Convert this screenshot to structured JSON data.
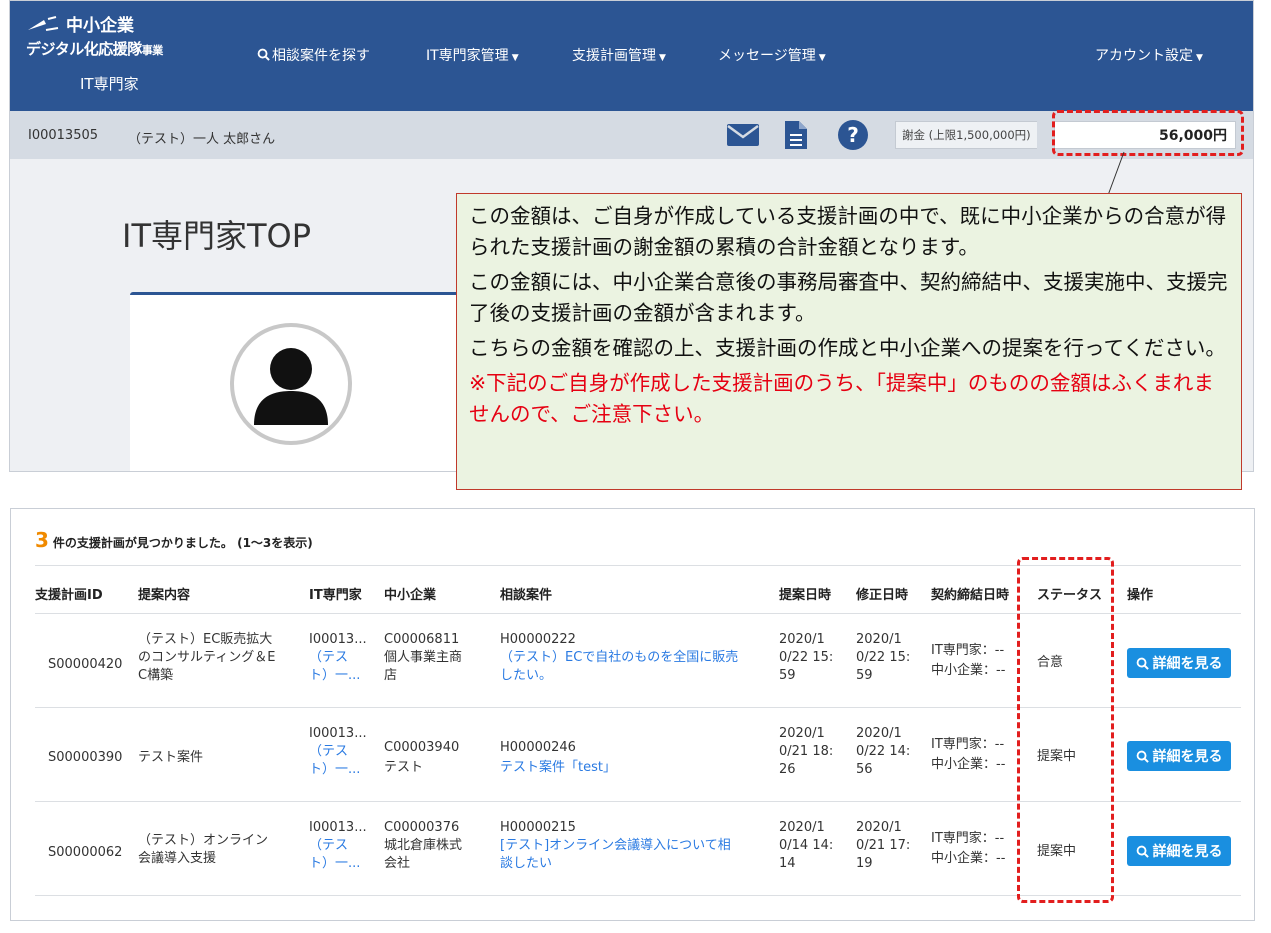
{
  "header": {
    "logo_line1": "中小企業",
    "logo_line2": "デジタル化応援隊",
    "logo_suffix": "事業",
    "role": "IT専門家",
    "nav": [
      {
        "label": "相談案件を探す"
      },
      {
        "label": "IT専門家管理"
      },
      {
        "label": "支援計画管理"
      },
      {
        "label": "メッセージ管理"
      }
    ],
    "account": "アカウント設定"
  },
  "subbar": {
    "user_id": "I00013505",
    "user_name": "（テスト）一人 太郎さん",
    "fee_label": "謝金 (上限1,500,000円)",
    "fee_value": "56,000円"
  },
  "page": {
    "title": "IT専門家TOP"
  },
  "callout": {
    "p1": "この金額は、ご自身が作成している支援計画の中で、既に中小企業からの合意が得られた支援計画の謝金額の累積の合計金額となります。",
    "p2": "この金額には、中小企業合意後の事務局審査中、契約締結中、支援実施中、支援完了後の支援計画の金額が含まれます。",
    "p3": "こちらの金額を確認の上、支援計画の作成と中小企業への提案を行ってください。",
    "warning": "※下記のご自身が作成した支援計画のうち、「提案中」のものの金額はふくまれませんので、ご注意下さい。"
  },
  "results": {
    "count": "3",
    "text": "件の支援計画が見つかりました。 (1〜3を表示)",
    "columns": [
      "支援計画ID",
      "提案内容",
      "IT専門家",
      "中小企業",
      "相談案件",
      "提案日時",
      "修正日時",
      "契約締結日時",
      "ステータス",
      "操作"
    ],
    "rows": [
      {
        "id": "S00000420",
        "proposal": [
          "（テスト）EC販売拡大",
          "のコンサルティング＆E",
          "C構築"
        ],
        "expert_id": "I00013...",
        "expert_link": [
          "（テス",
          "ト）一..."
        ],
        "sme_id": "C00006811",
        "sme_name": [
          "個人事業主商",
          "店"
        ],
        "case_id": "H00000222",
        "case_link": [
          "（テスト）ECで自社のものを全国に販売",
          "したい。"
        ],
        "proposed": [
          "2020/1",
          "0/22 15:",
          "59"
        ],
        "modified": [
          "2020/1",
          "0/22 15:",
          "59"
        ],
        "contract": [
          "IT専門家：--",
          "中小企業：--"
        ],
        "status": "合意",
        "action": "詳細を見る"
      },
      {
        "id": "S00000390",
        "proposal": [
          "テスト案件"
        ],
        "expert_id": "I00013...",
        "expert_link": [
          "（テス",
          "ト）一..."
        ],
        "sme_id": "C00003940",
        "sme_name": [
          "テスト"
        ],
        "case_id": "H00000246",
        "case_link": [
          "テスト案件「test」"
        ],
        "proposed": [
          "2020/1",
          "0/21 18:",
          "26"
        ],
        "modified": [
          "2020/1",
          "0/22 14:",
          "56"
        ],
        "contract": [
          "IT専門家：--",
          "中小企業：--"
        ],
        "status": "提案中",
        "action": "詳細を見る"
      },
      {
        "id": "S00000062",
        "proposal": [
          "（テスト）オンライン",
          "会議導入支援"
        ],
        "expert_id": "I00013...",
        "expert_link": [
          "（テス",
          "ト）一..."
        ],
        "sme_id": "C00000376",
        "sme_name": [
          "城北倉庫株式",
          "会社"
        ],
        "case_id": "H00000215",
        "case_link": [
          "[テスト]オンライン会議導入について相",
          "談したい"
        ],
        "proposed": [
          "2020/1",
          "0/14 14:",
          "14"
        ],
        "modified": [
          "2020/1",
          "0/21 17:",
          "19"
        ],
        "contract": [
          "IT専門家：--",
          "中小企業：--"
        ],
        "status": "提案中",
        "action": "詳細を見る"
      }
    ]
  },
  "colors": {
    "navbar": "#2c5593",
    "accent_button": "#1a8fe0",
    "highlight_dash": "#e21e1e",
    "callout_bg": "#ebf3e1",
    "warning_text": "#e60012",
    "count": "#f08a00"
  },
  "icons": [
    "search-icon",
    "envelope-icon",
    "document-icon",
    "help-icon",
    "avatar-icon"
  ]
}
